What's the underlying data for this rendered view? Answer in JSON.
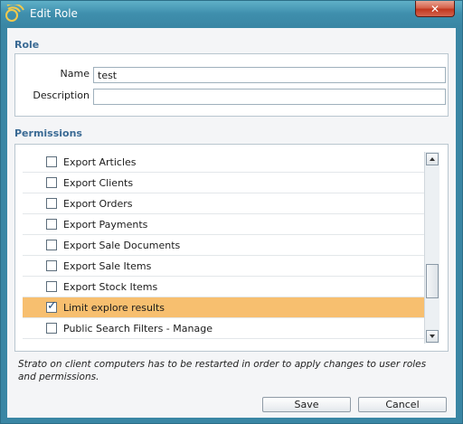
{
  "window": {
    "title": "Edit Role",
    "close_glyph": "✕",
    "accent_color": "#3a86a4",
    "icon": "app-logo-icon"
  },
  "role": {
    "section_title": "Role",
    "name_label": "Name",
    "name_value": "test",
    "description_label": "Description",
    "description_value": ""
  },
  "permissions": {
    "section_title": "Permissions",
    "items": [
      {
        "label": "Export Articles",
        "checked": false,
        "selected": false
      },
      {
        "label": "Export Clients",
        "checked": false,
        "selected": false
      },
      {
        "label": "Export Orders",
        "checked": false,
        "selected": false
      },
      {
        "label": "Export Payments",
        "checked": false,
        "selected": false
      },
      {
        "label": "Export Sale Documents",
        "checked": false,
        "selected": false
      },
      {
        "label": "Export Sale Items",
        "checked": false,
        "selected": false
      },
      {
        "label": "Export Stock Items",
        "checked": false,
        "selected": false
      },
      {
        "label": "Limit explore results",
        "checked": true,
        "selected": true
      },
      {
        "label": "Public Search Filters - Manage",
        "checked": false,
        "selected": false
      }
    ],
    "selected_color": "#f7bf6f"
  },
  "note": "Strato on client computers has to be restarted in order to apply changes to user roles and permissions.",
  "buttons": {
    "save": "Save",
    "cancel": "Cancel"
  }
}
